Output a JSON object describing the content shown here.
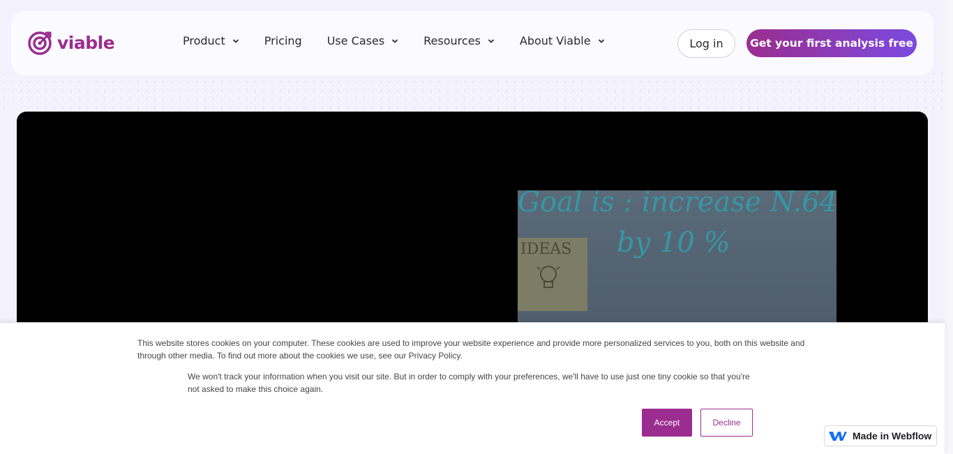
{
  "brand": {
    "name": "viable",
    "accent": "#9a2d8f",
    "gradient_end": "#7b4ae0"
  },
  "nav": {
    "items": [
      {
        "label": "Product",
        "has_dropdown": true
      },
      {
        "label": "Pricing",
        "has_dropdown": false
      },
      {
        "label": "Use Cases",
        "has_dropdown": true
      },
      {
        "label": "Resources",
        "has_dropdown": true
      },
      {
        "label": "About Viable",
        "has_dropdown": true
      }
    ],
    "login_label": "Log in",
    "cta_label": "Get your first analysis free"
  },
  "video": {
    "whiteboard_line1": "Goal is : increase N.64",
    "whiteboard_line2": "by 10 %",
    "note_label": "IDEAS"
  },
  "cookie_banner": {
    "paragraph1": "This website stores cookies on your computer. These cookies are used to improve your website experience and provide more personalized services to you, both on this website and through other media. To find out more about the cookies we use, see our Privacy Policy.",
    "paragraph2": "We won't track your information when you visit our site. But in order to comply with your preferences, we'll have to use just one tiny cookie so that you're not asked to make this choice again.",
    "accept_label": "Accept",
    "decline_label": "Decline"
  },
  "badge": {
    "label": "Made in Webflow",
    "icon": "webflow-icon"
  }
}
